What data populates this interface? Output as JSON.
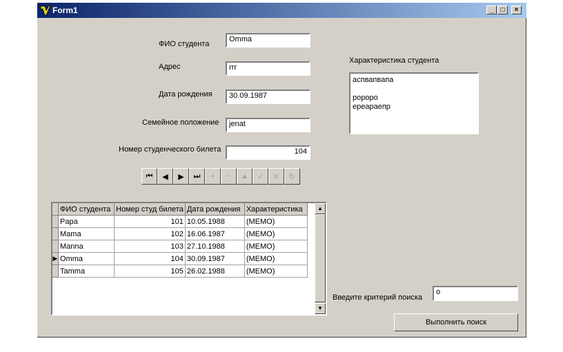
{
  "window": {
    "title": "Form1",
    "min_icon": "minimize-icon",
    "max_icon": "maximize-icon",
    "close_icon": "close-icon"
  },
  "fields": {
    "fio_label": "ФИО студента",
    "fio_value": "Omma",
    "address_label": "Адрес",
    "address_value": "rrr",
    "birth_label": "Дата рождения",
    "birth_value": "30.09.1987",
    "family_label": "Семейное положение",
    "family_value": "jenat",
    "ticket_label": "Номер студенческого билета",
    "ticket_value": "104"
  },
  "characteristic": {
    "label": "Характеристика студента",
    "text": "аспвапвапа\n\nророрo\nереараепр"
  },
  "navigator": {
    "buttons": [
      {
        "name": "first",
        "glyph": "⏮"
      },
      {
        "name": "prior",
        "glyph": "◀"
      },
      {
        "name": "next",
        "glyph": "▶"
      },
      {
        "name": "last",
        "glyph": "⏭"
      },
      {
        "name": "insert",
        "glyph": "+"
      },
      {
        "name": "delete",
        "glyph": "−"
      },
      {
        "name": "edit",
        "glyph": "▲"
      },
      {
        "name": "post",
        "glyph": "✓"
      },
      {
        "name": "cancel",
        "glyph": "✕"
      },
      {
        "name": "refresh",
        "glyph": "↻"
      }
    ]
  },
  "grid": {
    "columns": [
      "ФИО студента",
      "Номер студ билета",
      "Дата рождения",
      "Характеристика"
    ],
    "rows": [
      [
        "Papa",
        "101",
        "10.05.1988",
        "(MEMO)"
      ],
      [
        "Mama",
        "102",
        "16.06.1987",
        "(MEMO)"
      ],
      [
        "Manna",
        "103",
        "27.10.1988",
        "(MEMO)"
      ],
      [
        "Omma",
        "104",
        "30.09.1987",
        "(MEMO)"
      ],
      [
        "Tamma",
        "105",
        "26.02.1988",
        "(MEMO)"
      ]
    ],
    "current_row": 3
  },
  "search": {
    "label": "Введите  критерий поиска",
    "value": "o",
    "button": "Выполнить поиск"
  }
}
